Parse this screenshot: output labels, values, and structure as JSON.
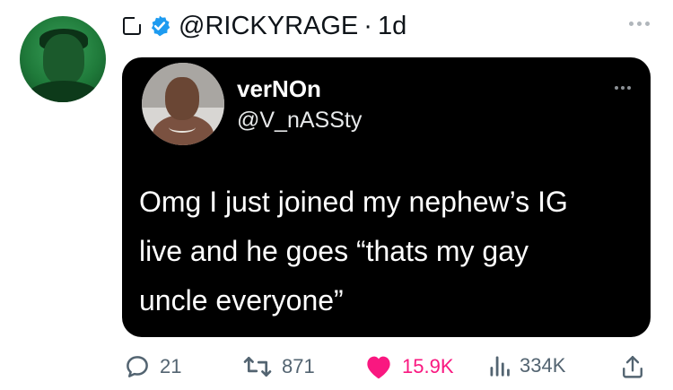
{
  "tweet": {
    "handle": "@RICKYRAGE",
    "separator": "·",
    "time": "1d"
  },
  "quoted": {
    "name": "verNOn",
    "handle": "@V_nASSty",
    "lines": [
      "Omg I just joined my nephew’s IG",
      "live and he goes “thats my gay",
      "uncle everyone”"
    ]
  },
  "actions": {
    "replies": "21",
    "retweets": "871",
    "likes": "15.9K",
    "views": "334K"
  },
  "colors": {
    "like": "#f91880",
    "verified": "#1d9bf0",
    "muted": "#536471",
    "card_bg": "#000000"
  },
  "icons": [
    "square-icon",
    "verified-icon",
    "more-dots-icon",
    "reply-icon",
    "retweet-icon",
    "heart-icon",
    "views-icon",
    "share-icon"
  ]
}
